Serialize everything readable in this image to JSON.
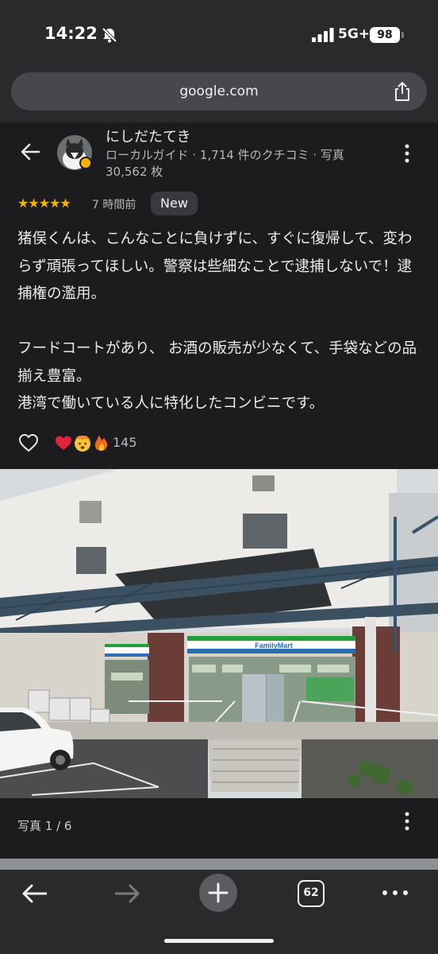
{
  "status": {
    "time": "14:22",
    "network": "5G+",
    "battery": "98"
  },
  "browser": {
    "url": "google.com",
    "tab_count": "62"
  },
  "review": {
    "user_name": "にしだたてき",
    "user_meta": "ローカルガイド · 1,714 件のクチコミ · 写真 30,562 枚",
    "rating": 5,
    "stars": "★★★★★",
    "time_ago": "7 時間前",
    "badge": "New",
    "paragraphs": [
      "猪俣くんは、こんなことに負けずに、すぐに復帰して、変わらず頑張ってほしい。警察は些細なことで逮捕しないで！逮捕権の濫用。",
      "フードコートがあり、 お酒の販売が少なくて、手袋などの品揃え豊富。\n港湾で働いている人に特化したコンビニです。"
    ],
    "reaction_count": "145",
    "photo_caption": "写真 1 / 6"
  },
  "photo": {
    "store_sign": "FamilyMart"
  },
  "colors": {
    "background": "#1c1c1e",
    "bar": "#2a2a2c",
    "star": "#f4b400",
    "familymart_green": "#1f9e3a",
    "familymart_blue": "#2d6bb7"
  },
  "icons": [
    "bell-slash-icon",
    "signal-icon",
    "share-icon",
    "back-arrow-icon",
    "more-vert-icon",
    "heart-icon",
    "forward-arrow-icon",
    "plus-icon",
    "tabs-icon",
    "more-horiz-icon"
  ]
}
